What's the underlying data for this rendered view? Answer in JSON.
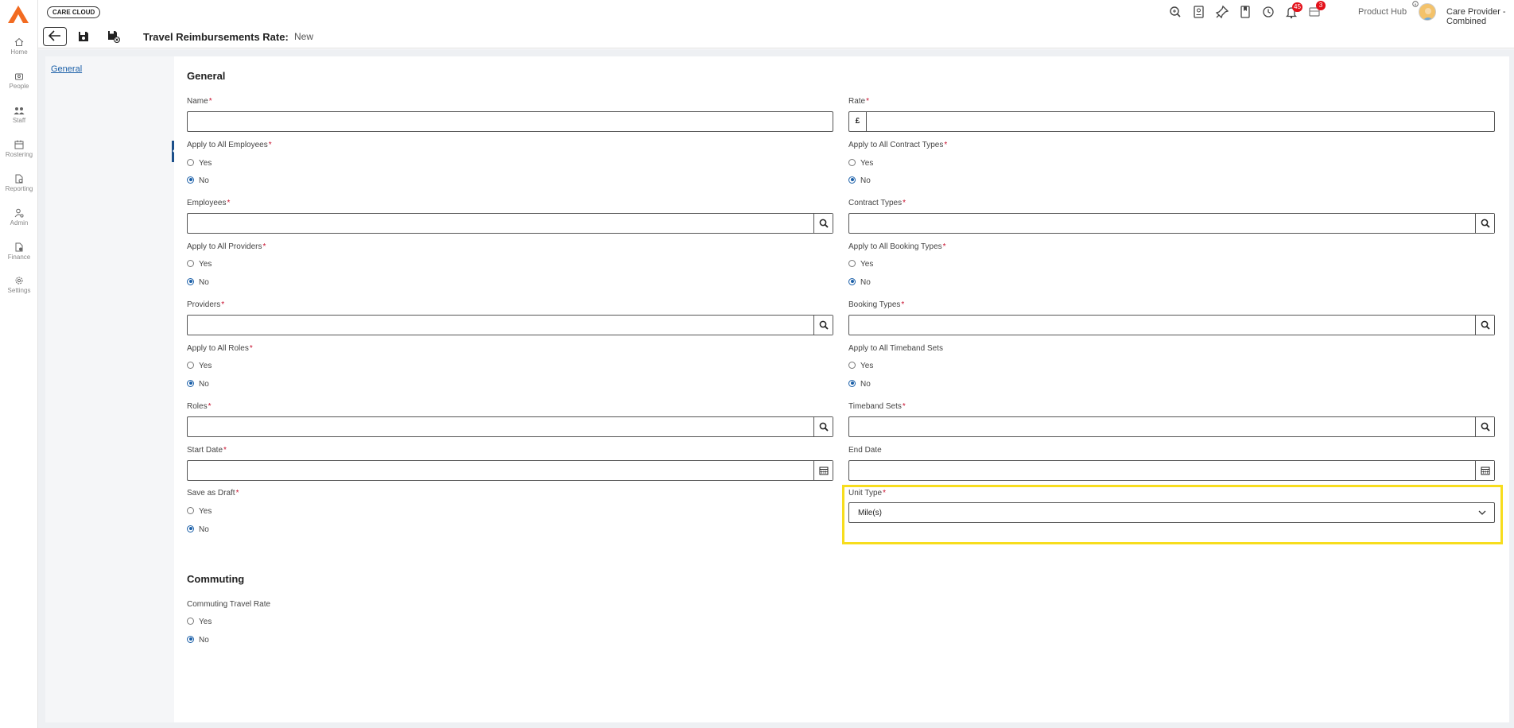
{
  "app": {
    "brand": "CARE CLOUD",
    "product_hub_label": "Product Hub",
    "user_name": "Care Provider - Combined",
    "notifications_count": "45",
    "product_hub_count": "3"
  },
  "nav": [
    {
      "label": "Home",
      "icon": "home-icon"
    },
    {
      "label": "People",
      "icon": "people-icon"
    },
    {
      "label": "Staff",
      "icon": "staff-icon"
    },
    {
      "label": "Rostering",
      "icon": "rostering-icon"
    },
    {
      "label": "Reporting",
      "icon": "reporting-icon"
    },
    {
      "label": "Admin",
      "icon": "admin-icon"
    },
    {
      "label": "Finance",
      "icon": "finance-icon"
    },
    {
      "label": "Settings",
      "icon": "settings-icon"
    }
  ],
  "toolbar": {
    "title": "Travel Reimbursements Rate:",
    "status": "New"
  },
  "side_nav": {
    "general_link": "General"
  },
  "form": {
    "general_title": "General",
    "commuting_title": "Commuting",
    "yes": "Yes",
    "no": "No",
    "required_mark": "*",
    "name_label": "Name",
    "rate_label": "Rate",
    "rate_currency": "£",
    "apply_employees_label": "Apply to All Employees",
    "apply_contract_label": "Apply to All Contract Types",
    "employees_label": "Employees",
    "contract_types_label": "Contract Types",
    "apply_providers_label": "Apply to All Providers",
    "apply_booking_label": "Apply to All Booking Types",
    "providers_label": "Providers",
    "booking_types_label": "Booking Types",
    "apply_roles_label": "Apply to All Roles",
    "apply_timeband_label": "Apply to All Timeband Sets",
    "roles_label": "Roles",
    "timeband_sets_label": "Timeband Sets",
    "start_date_label": "Start Date",
    "end_date_label": "End Date",
    "save_draft_label": "Save as Draft",
    "unit_type_label": "Unit Type",
    "unit_type_value": "Mile(s)",
    "commuting_rate_label": "Commuting Travel Rate"
  },
  "colors": {
    "accent": "#1a5fa8",
    "required": "#c8102e",
    "highlight": "#f7dd1d",
    "logo": "#f26b21"
  }
}
